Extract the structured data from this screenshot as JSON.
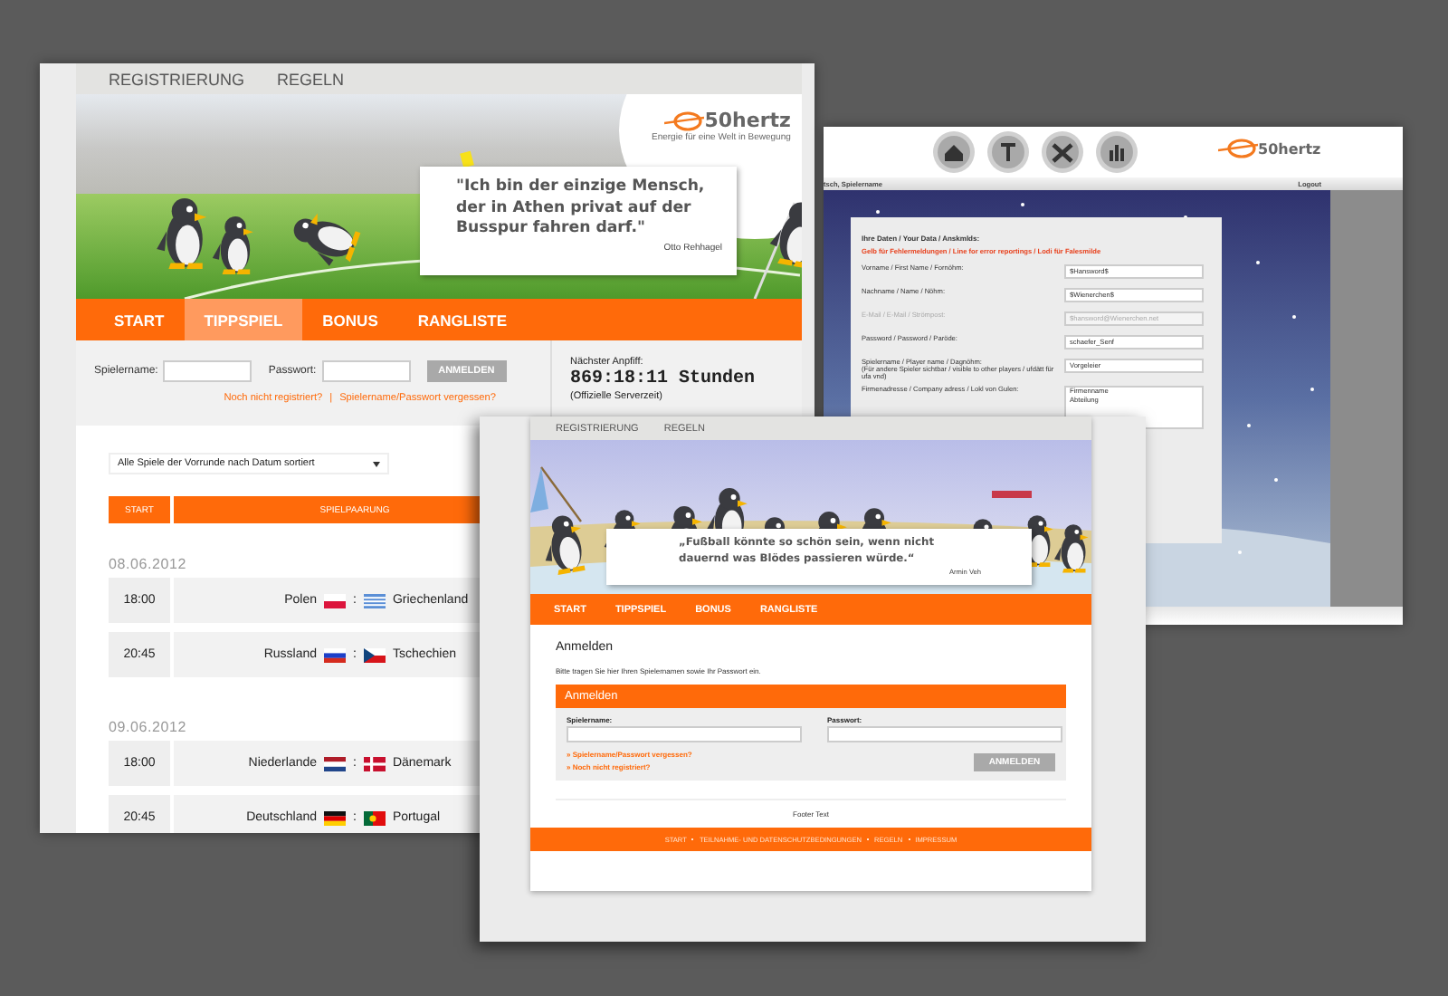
{
  "back_page": {
    "top_links": [
      "REGISTRIERUNG",
      "REGELN"
    ],
    "logo": {
      "name": "50hertz",
      "tagline": "Energie für eine Welt in Bewegung"
    },
    "quote": {
      "text": "\"Ich bin der einzige Mensch, der in Athen privat auf der Busspur fahren darf.\"",
      "author": "Otto Rehhagel"
    },
    "nav": [
      {
        "label": "START",
        "selected": false
      },
      {
        "label": "TIPPSPIEL",
        "selected": true
      },
      {
        "label": "BONUS",
        "selected": false
      },
      {
        "label": "RANGLISTE",
        "selected": false
      }
    ],
    "login": {
      "username_label": "Spielername:",
      "password_label": "Passwort:",
      "button": "ANMELDEN",
      "button_disabled": true,
      "links": [
        "Noch nicht registriert?",
        "Spielername/Passwort vergessen?"
      ],
      "separator": "|"
    },
    "kickoff": {
      "label": "Nächster Anpfiff:",
      "countdown": "869:18:11 Stunden",
      "note": "(Offizielle Serverzeit)"
    },
    "filter": {
      "value": "Alle Spiele der Vorrunde nach Datum sortiert"
    },
    "table": {
      "columns": [
        "START",
        "SPIELPAARUNG"
      ],
      "days": [
        {
          "date": "08.06.2012",
          "matches": [
            {
              "time": "18:00",
              "home": "Polen",
              "separator": ":",
              "away": "Griechenland"
            },
            {
              "time": "20:45",
              "home": "Russland",
              "separator": ":",
              "away": "Tschechien"
            }
          ]
        },
        {
          "date": "09.06.2012",
          "matches": [
            {
              "time": "18:00",
              "home": "Niederlande",
              "separator": ":",
              "away": "Dänemark"
            },
            {
              "time": "20:45",
              "home": "Deutschland",
              "separator": ":",
              "away": "Portugal"
            }
          ]
        }
      ]
    }
  },
  "settings_page": {
    "logo": "50hertz",
    "greeting": "tsch, Spielername",
    "logout": "Logout",
    "form": {
      "title": "Ihre Daten / Your Data / Anskmlds:",
      "notice": "Gelb für Fehlermeldungen / Line for error reportings / Lodi für Falesmilde",
      "fields": [
        {
          "kind": "input",
          "label": "Vorname / First Name / Fornöhm:",
          "value": "$Hansword$",
          "disabled": false
        },
        {
          "kind": "input",
          "label": "Nachname / Name / Nöhm:",
          "value": "$Wienerchen$",
          "disabled": false
        },
        {
          "kind": "input",
          "label": "E-Mail / E-Mail / Strömpost:",
          "value": "$hansword@Wienerchen.net",
          "disabled": true
        },
        {
          "kind": "input",
          "label": "Password / Password / Paröde:",
          "value": "schaefer_Senf",
          "disabled": false
        },
        {
          "kind": "input",
          "label": "Spielername / Player name / Dagnöhm:",
          "note": "(Für andere Spieler sichtbar / visible to other players / ufdätt für ufa vnd)",
          "value": "Vorgeleier",
          "disabled": false
        },
        {
          "kind": "textarea",
          "label": "Firmenadresse / Company adress / Lokl von Gulen:",
          "value": "Firmenname\nAbteilung",
          "disabled": false
        }
      ]
    }
  },
  "login_page": {
    "top_links": [
      "REGISTRIERUNG",
      "REGELN"
    ],
    "quote": {
      "text": "„Fußball könnte so schön sein, wenn nicht dauernd was Blödes passieren würde.“",
      "author": "Armin Veh"
    },
    "nav": [
      {
        "label": "START",
        "selected": false
      },
      {
        "label": "TIPPSPIEL",
        "selected": false
      },
      {
        "label": "BONUS",
        "selected": false
      },
      {
        "label": "RANGLISTE",
        "selected": false
      }
    ],
    "heading": "Anmelden",
    "intro": "Bitte tragen Sie hier Ihren Spielernamen sowie Ihr Passwort ein.",
    "panel": {
      "title": "Anmelden",
      "username_label": "Spielername:",
      "password_label": "Passwort:",
      "links": [
        "» Spielername/Passwort vergessen?",
        "» Noch nicht registriert?"
      ],
      "button": "ANMELDEN",
      "button_disabled": true
    },
    "footer_text": "Footer Text",
    "footer_links": [
      "START",
      "TEILNAHME- UND DATENSCHUTZBEDINGUNGEN",
      "REGELN",
      "IMPRESSUM"
    ]
  }
}
